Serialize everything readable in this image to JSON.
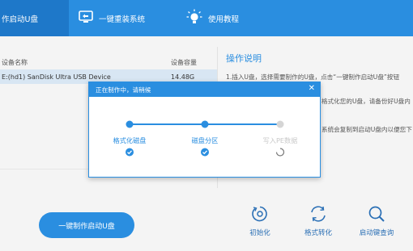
{
  "nav": {
    "tabs": [
      {
        "label": "作启动U盘",
        "icon": "usb-icon",
        "active": true
      },
      {
        "label": "一键重装系统",
        "icon": "monitor-icon",
        "active": false
      },
      {
        "label": "使用教程",
        "icon": "lightbulb-icon",
        "active": false
      }
    ]
  },
  "device_table": {
    "headers": [
      "设备名称",
      "设备容量"
    ],
    "rows": [
      {
        "name": "E:(hd1) SanDisk Ultra USB Device",
        "capacity": "14.48G"
      }
    ]
  },
  "instructions": {
    "title": "操作说明",
    "lines": [
      "1.插入U盘，选择需要制作的U盘，点击“一键制作启动U盘”按钮",
      "格式化您的U盘，请备份好U盘内",
      "系统会复制到启动U盘内以便您下"
    ]
  },
  "actions": {
    "make_button": "一键制作启动U盘",
    "tools": [
      {
        "label": "初始化",
        "icon": "disc-icon"
      },
      {
        "label": "格式转化",
        "icon": "convert-icon"
      },
      {
        "label": "启动键查询",
        "icon": "search-icon"
      }
    ]
  },
  "dialog": {
    "title": "正在制作中，请稍候",
    "close": "✕",
    "steps": [
      {
        "label": "格式化磁盘",
        "status": "done"
      },
      {
        "label": "磁盘分区",
        "status": "done"
      },
      {
        "label": "写入PE数据",
        "status": "in-progress"
      }
    ]
  },
  "colors": {
    "accent": "#2a8ee0",
    "accent_dark": "#1e78c9",
    "pending": "#d5d5d5"
  }
}
